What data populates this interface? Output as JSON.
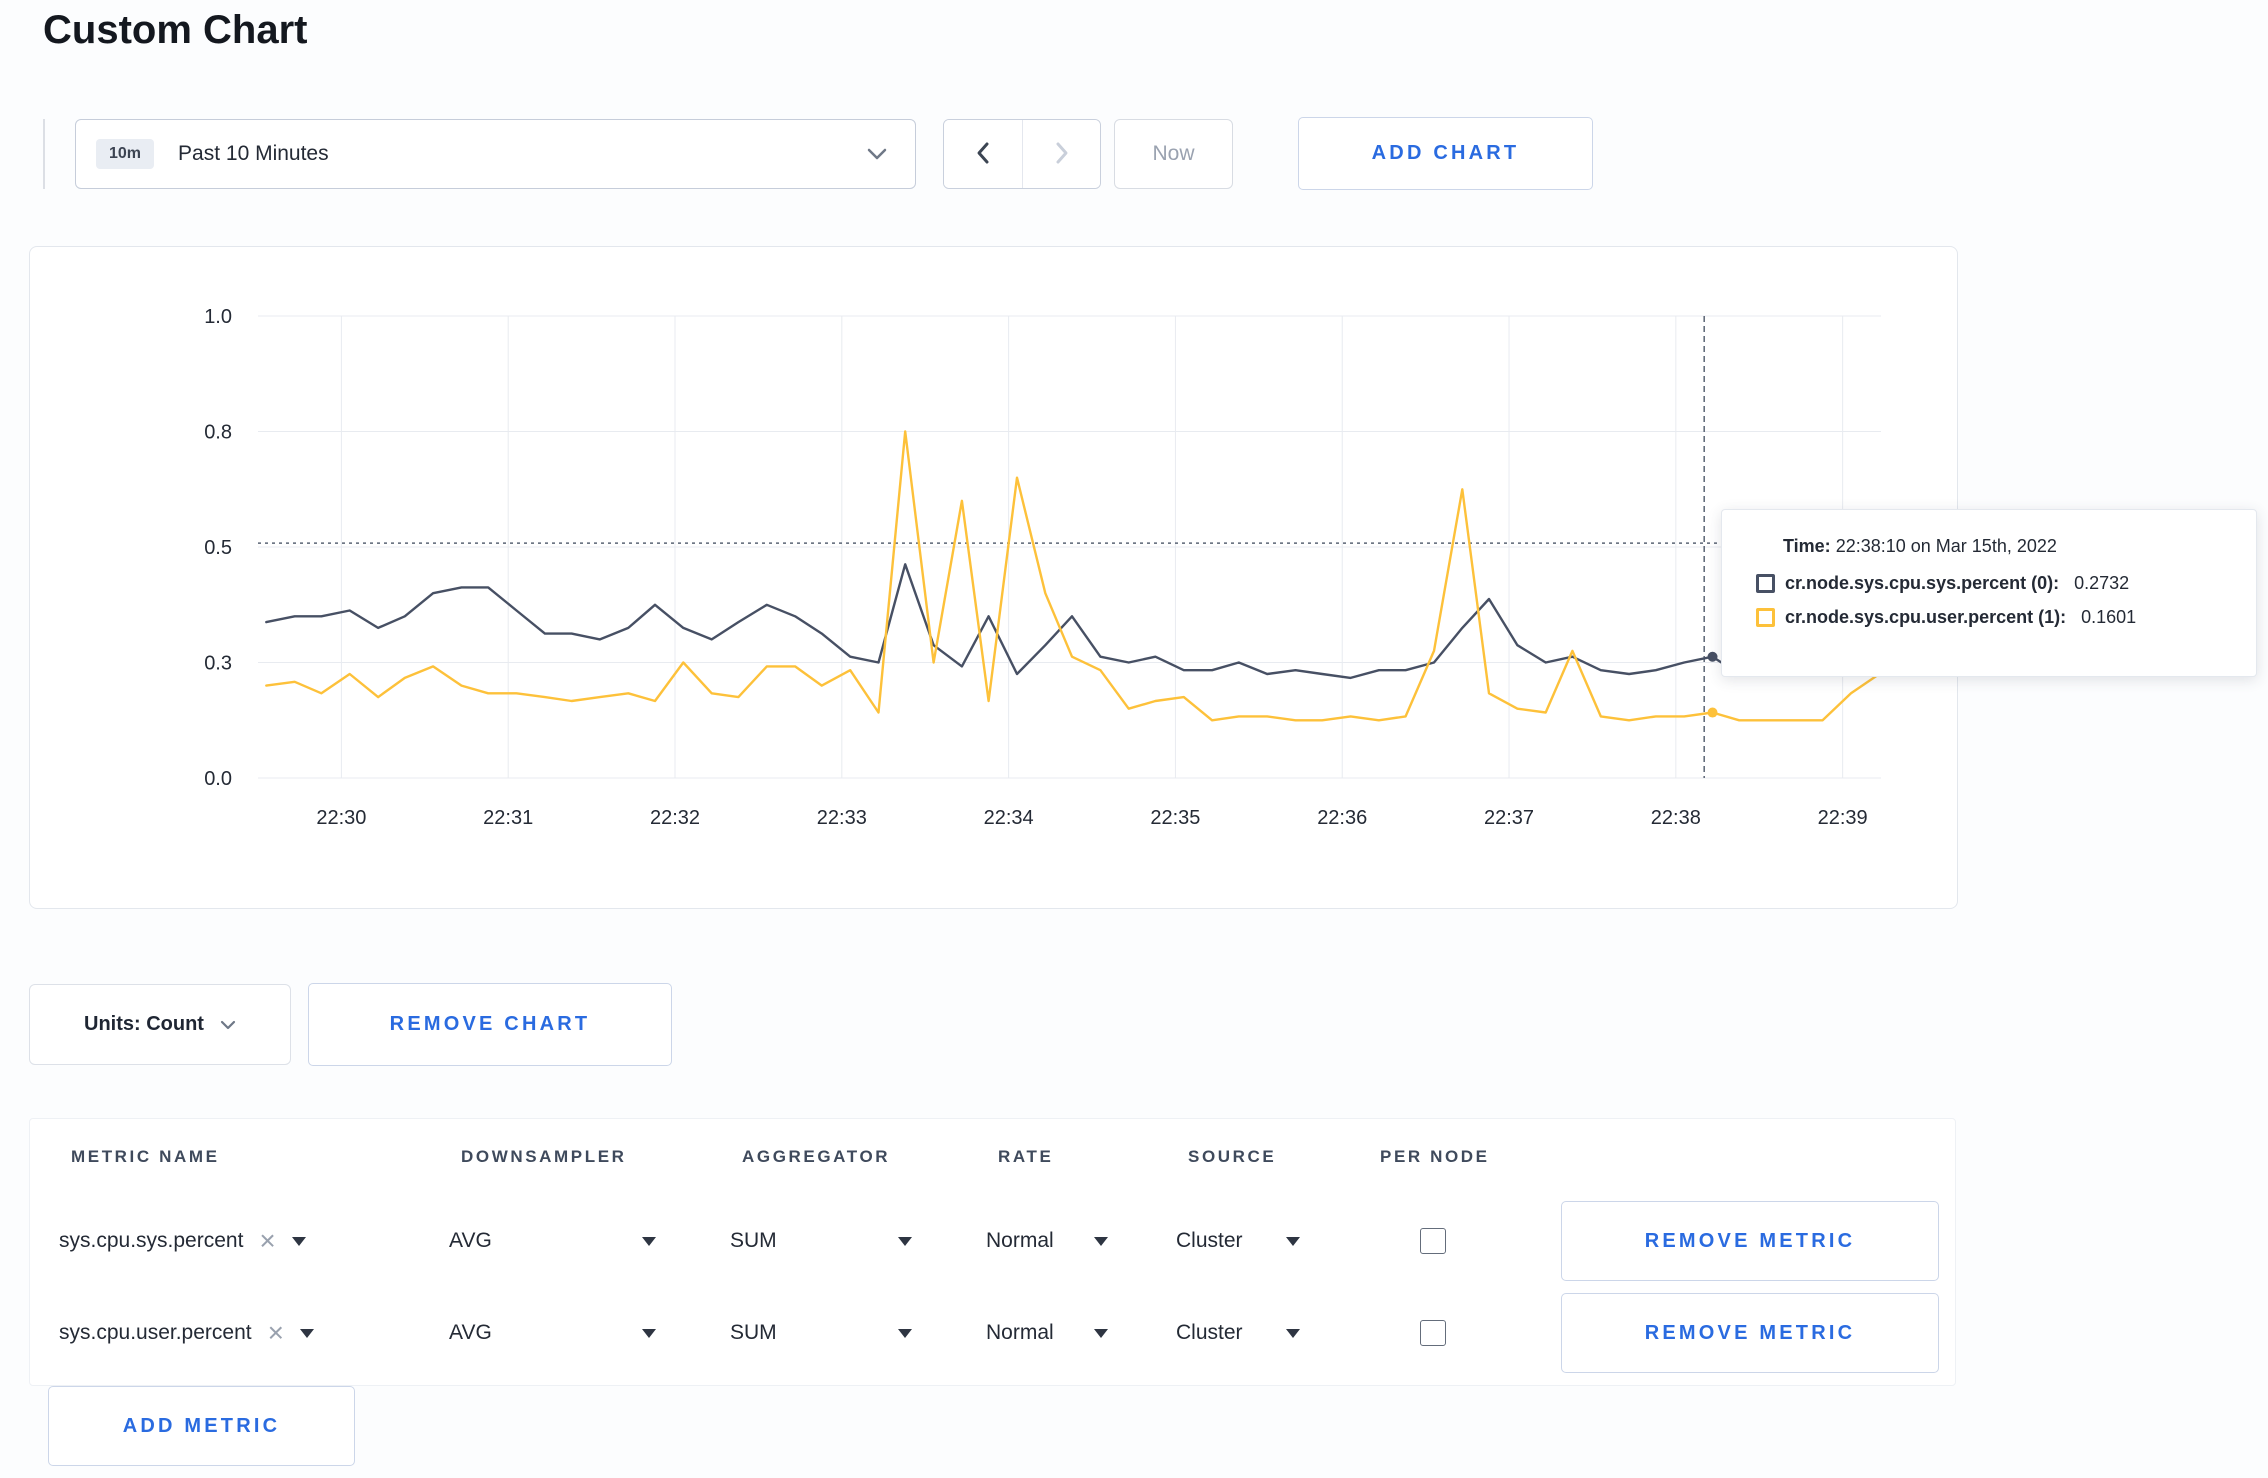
{
  "page": {
    "title": "Custom Chart"
  },
  "toolbar": {
    "range_badge": "10m",
    "range_label": "Past 10 Minutes",
    "now_label": "Now",
    "add_chart_label": "ADD CHART"
  },
  "chart_controls": {
    "units_label": "Units: Count",
    "remove_chart_label": "REMOVE CHART"
  },
  "tooltip": {
    "time_label": "Time:",
    "time_value": "22:38:10 on Mar 15th, 2022",
    "series": [
      {
        "label": "cr.node.sys.cpu.sys.percent (0):",
        "value": "0.2732",
        "color": "#475064"
      },
      {
        "label": "cr.node.sys.cpu.user.percent (1):",
        "value": "0.1601",
        "color": "#fdc13a"
      }
    ]
  },
  "colors": {
    "accent_blue": "#2a6be0",
    "series_sys": "#475064",
    "series_user": "#fdc13a"
  },
  "chart_data": {
    "type": "line",
    "x_domain": [
      29.5,
      39.23
    ],
    "x_ticks": [
      30,
      31,
      32,
      33,
      34,
      35,
      36,
      37,
      38,
      39
    ],
    "x_tick_labels": [
      "22:30",
      "22:31",
      "22:32",
      "22:33",
      "22:34",
      "22:35",
      "22:36",
      "22:37",
      "22:38",
      "22:39"
    ],
    "y_ticks": [
      0,
      0.3,
      0.5,
      0.8,
      1.0
    ],
    "y_tick_labels": [
      "0.0",
      "0.3",
      "0.5",
      "0.8",
      "1.0"
    ],
    "crosshair": {
      "time": 38.17,
      "hline_value": 0.51
    },
    "x": [
      29.55,
      29.72,
      29.88,
      30.05,
      30.22,
      30.38,
      30.55,
      30.72,
      30.88,
      31.05,
      31.22,
      31.38,
      31.55,
      31.72,
      31.88,
      32.05,
      32.22,
      32.38,
      32.55,
      32.72,
      32.88,
      33.05,
      33.22,
      33.38,
      33.55,
      33.72,
      33.88,
      34.05,
      34.22,
      34.38,
      34.55,
      34.72,
      34.88,
      35.05,
      35.22,
      35.38,
      35.55,
      35.72,
      35.88,
      36.05,
      36.22,
      36.38,
      36.55,
      36.72,
      36.88,
      37.05,
      37.22,
      37.38,
      37.55,
      37.72,
      37.88,
      38.05,
      38.22,
      38.38,
      38.55,
      38.72,
      38.88,
      39.05,
      39.22
    ],
    "series": [
      {
        "name": "cr.node.sys.cpu.sys.percent",
        "color": "#475064",
        "values": [
          0.37,
          0.38,
          0.38,
          0.39,
          0.36,
          0.38,
          0.42,
          0.43,
          0.43,
          0.39,
          0.35,
          0.35,
          0.34,
          0.36,
          0.4,
          0.36,
          0.34,
          0.37,
          0.4,
          0.38,
          0.35,
          0.31,
          0.3,
          0.47,
          0.33,
          0.29,
          0.38,
          0.27,
          0.33,
          0.38,
          0.31,
          0.3,
          0.31,
          0.28,
          0.28,
          0.3,
          0.27,
          0.28,
          0.27,
          0.26,
          0.28,
          0.28,
          0.3,
          0.36,
          0.41,
          0.33,
          0.3,
          0.31,
          0.28,
          0.27,
          0.28,
          0.3,
          0.31,
          0.27,
          0.28,
          0.3,
          0.28,
          0.3,
          0.3
        ]
      },
      {
        "name": "cr.node.sys.cpu.user.percent",
        "color": "#fdc13a",
        "values": [
          0.24,
          0.25,
          0.22,
          0.27,
          0.21,
          0.26,
          0.29,
          0.24,
          0.22,
          0.22,
          0.21,
          0.2,
          0.21,
          0.22,
          0.2,
          0.3,
          0.22,
          0.21,
          0.29,
          0.29,
          0.24,
          0.28,
          0.17,
          0.8,
          0.3,
          0.62,
          0.2,
          0.68,
          0.42,
          0.31,
          0.28,
          0.18,
          0.2,
          0.21,
          0.15,
          0.16,
          0.16,
          0.15,
          0.15,
          0.16,
          0.15,
          0.16,
          0.32,
          0.65,
          0.22,
          0.18,
          0.17,
          0.32,
          0.16,
          0.15,
          0.16,
          0.16,
          0.17,
          0.15,
          0.15,
          0.15,
          0.15,
          0.22,
          0.27
        ]
      }
    ]
  },
  "metrics_table": {
    "headers": [
      "METRIC NAME",
      "DOWNSAMPLER",
      "AGGREGATOR",
      "RATE",
      "SOURCE",
      "PER NODE"
    ],
    "rows": [
      {
        "metric": "sys.cpu.sys.percent",
        "downsampler": "AVG",
        "aggregator": "SUM",
        "rate": "Normal",
        "source": "Cluster",
        "per_node_checked": false,
        "remove_label": "REMOVE METRIC"
      },
      {
        "metric": "sys.cpu.user.percent",
        "downsampler": "AVG",
        "aggregator": "SUM",
        "rate": "Normal",
        "source": "Cluster",
        "per_node_checked": false,
        "remove_label": "REMOVE METRIC"
      }
    ],
    "add_metric_label": "ADD METRIC"
  }
}
